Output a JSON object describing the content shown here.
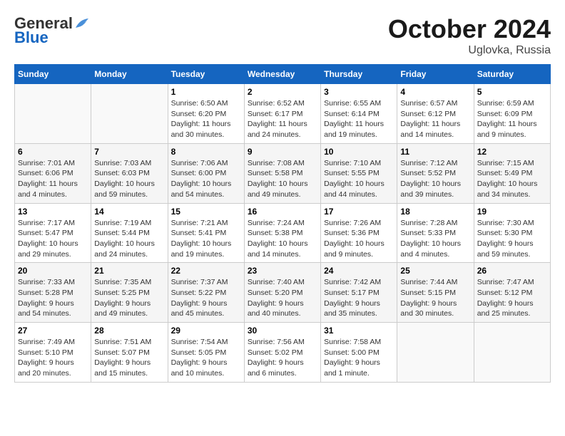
{
  "header": {
    "logo_general": "General",
    "logo_blue": "Blue",
    "title": "October 2024",
    "subtitle": "Uglovka, Russia"
  },
  "weekdays": [
    "Sunday",
    "Monday",
    "Tuesday",
    "Wednesday",
    "Thursday",
    "Friday",
    "Saturday"
  ],
  "weeks": [
    [
      {
        "day": "",
        "sunrise": "",
        "sunset": "",
        "daylight": ""
      },
      {
        "day": "",
        "sunrise": "",
        "sunset": "",
        "daylight": ""
      },
      {
        "day": "1",
        "sunrise": "Sunrise: 6:50 AM",
        "sunset": "Sunset: 6:20 PM",
        "daylight": "Daylight: 11 hours and 30 minutes."
      },
      {
        "day": "2",
        "sunrise": "Sunrise: 6:52 AM",
        "sunset": "Sunset: 6:17 PM",
        "daylight": "Daylight: 11 hours and 24 minutes."
      },
      {
        "day": "3",
        "sunrise": "Sunrise: 6:55 AM",
        "sunset": "Sunset: 6:14 PM",
        "daylight": "Daylight: 11 hours and 19 minutes."
      },
      {
        "day": "4",
        "sunrise": "Sunrise: 6:57 AM",
        "sunset": "Sunset: 6:12 PM",
        "daylight": "Daylight: 11 hours and 14 minutes."
      },
      {
        "day": "5",
        "sunrise": "Sunrise: 6:59 AM",
        "sunset": "Sunset: 6:09 PM",
        "daylight": "Daylight: 11 hours and 9 minutes."
      }
    ],
    [
      {
        "day": "6",
        "sunrise": "Sunrise: 7:01 AM",
        "sunset": "Sunset: 6:06 PM",
        "daylight": "Daylight: 11 hours and 4 minutes."
      },
      {
        "day": "7",
        "sunrise": "Sunrise: 7:03 AM",
        "sunset": "Sunset: 6:03 PM",
        "daylight": "Daylight: 10 hours and 59 minutes."
      },
      {
        "day": "8",
        "sunrise": "Sunrise: 7:06 AM",
        "sunset": "Sunset: 6:00 PM",
        "daylight": "Daylight: 10 hours and 54 minutes."
      },
      {
        "day": "9",
        "sunrise": "Sunrise: 7:08 AM",
        "sunset": "Sunset: 5:58 PM",
        "daylight": "Daylight: 10 hours and 49 minutes."
      },
      {
        "day": "10",
        "sunrise": "Sunrise: 7:10 AM",
        "sunset": "Sunset: 5:55 PM",
        "daylight": "Daylight: 10 hours and 44 minutes."
      },
      {
        "day": "11",
        "sunrise": "Sunrise: 7:12 AM",
        "sunset": "Sunset: 5:52 PM",
        "daylight": "Daylight: 10 hours and 39 minutes."
      },
      {
        "day": "12",
        "sunrise": "Sunrise: 7:15 AM",
        "sunset": "Sunset: 5:49 PM",
        "daylight": "Daylight: 10 hours and 34 minutes."
      }
    ],
    [
      {
        "day": "13",
        "sunrise": "Sunrise: 7:17 AM",
        "sunset": "Sunset: 5:47 PM",
        "daylight": "Daylight: 10 hours and 29 minutes."
      },
      {
        "day": "14",
        "sunrise": "Sunrise: 7:19 AM",
        "sunset": "Sunset: 5:44 PM",
        "daylight": "Daylight: 10 hours and 24 minutes."
      },
      {
        "day": "15",
        "sunrise": "Sunrise: 7:21 AM",
        "sunset": "Sunset: 5:41 PM",
        "daylight": "Daylight: 10 hours and 19 minutes."
      },
      {
        "day": "16",
        "sunrise": "Sunrise: 7:24 AM",
        "sunset": "Sunset: 5:38 PM",
        "daylight": "Daylight: 10 hours and 14 minutes."
      },
      {
        "day": "17",
        "sunrise": "Sunrise: 7:26 AM",
        "sunset": "Sunset: 5:36 PM",
        "daylight": "Daylight: 10 hours and 9 minutes."
      },
      {
        "day": "18",
        "sunrise": "Sunrise: 7:28 AM",
        "sunset": "Sunset: 5:33 PM",
        "daylight": "Daylight: 10 hours and 4 minutes."
      },
      {
        "day": "19",
        "sunrise": "Sunrise: 7:30 AM",
        "sunset": "Sunset: 5:30 PM",
        "daylight": "Daylight: 9 hours and 59 minutes."
      }
    ],
    [
      {
        "day": "20",
        "sunrise": "Sunrise: 7:33 AM",
        "sunset": "Sunset: 5:28 PM",
        "daylight": "Daylight: 9 hours and 54 minutes."
      },
      {
        "day": "21",
        "sunrise": "Sunrise: 7:35 AM",
        "sunset": "Sunset: 5:25 PM",
        "daylight": "Daylight: 9 hours and 49 minutes."
      },
      {
        "day": "22",
        "sunrise": "Sunrise: 7:37 AM",
        "sunset": "Sunset: 5:22 PM",
        "daylight": "Daylight: 9 hours and 45 minutes."
      },
      {
        "day": "23",
        "sunrise": "Sunrise: 7:40 AM",
        "sunset": "Sunset: 5:20 PM",
        "daylight": "Daylight: 9 hours and 40 minutes."
      },
      {
        "day": "24",
        "sunrise": "Sunrise: 7:42 AM",
        "sunset": "Sunset: 5:17 PM",
        "daylight": "Daylight: 9 hours and 35 minutes."
      },
      {
        "day": "25",
        "sunrise": "Sunrise: 7:44 AM",
        "sunset": "Sunset: 5:15 PM",
        "daylight": "Daylight: 9 hours and 30 minutes."
      },
      {
        "day": "26",
        "sunrise": "Sunrise: 7:47 AM",
        "sunset": "Sunset: 5:12 PM",
        "daylight": "Daylight: 9 hours and 25 minutes."
      }
    ],
    [
      {
        "day": "27",
        "sunrise": "Sunrise: 7:49 AM",
        "sunset": "Sunset: 5:10 PM",
        "daylight": "Daylight: 9 hours and 20 minutes."
      },
      {
        "day": "28",
        "sunrise": "Sunrise: 7:51 AM",
        "sunset": "Sunset: 5:07 PM",
        "daylight": "Daylight: 9 hours and 15 minutes."
      },
      {
        "day": "29",
        "sunrise": "Sunrise: 7:54 AM",
        "sunset": "Sunset: 5:05 PM",
        "daylight": "Daylight: 9 hours and 10 minutes."
      },
      {
        "day": "30",
        "sunrise": "Sunrise: 7:56 AM",
        "sunset": "Sunset: 5:02 PM",
        "daylight": "Daylight: 9 hours and 6 minutes."
      },
      {
        "day": "31",
        "sunrise": "Sunrise: 7:58 AM",
        "sunset": "Sunset: 5:00 PM",
        "daylight": "Daylight: 9 hours and 1 minute."
      },
      {
        "day": "",
        "sunrise": "",
        "sunset": "",
        "daylight": ""
      },
      {
        "day": "",
        "sunrise": "",
        "sunset": "",
        "daylight": ""
      }
    ]
  ]
}
